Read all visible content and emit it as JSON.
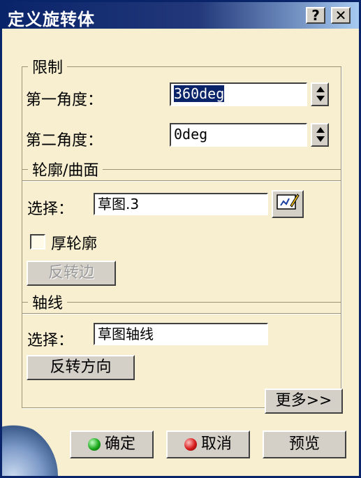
{
  "window": {
    "title": "定义旋转体",
    "help_label": "?",
    "close_label": "✕"
  },
  "limits": {
    "legend": "限制",
    "first_angle_label": "第一角度：",
    "first_angle_value": "360deg",
    "second_angle_label": "第二角度：",
    "second_angle_value": "0deg"
  },
  "profile": {
    "legend": "轮廓/曲面",
    "select_label": "选择：",
    "select_value": "草图.3",
    "thick_profile_label": "厚轮廓",
    "reverse_side_label": "反转边"
  },
  "axis": {
    "legend": "轴线",
    "select_label": "选择：",
    "select_value": "草图轴线",
    "reverse_direction_label": "反转方向"
  },
  "more_label": "更多>>",
  "buttons": {
    "ok_label": "确定",
    "cancel_label": "取消",
    "preview_label": "预览"
  },
  "icons": {
    "sketch_button": "sketch-edit-icon",
    "ok_indicator": "green-ball-icon",
    "cancel_indicator": "red-ball-icon"
  },
  "colors": {
    "dialog_bg": "#f7efd0",
    "titlebar": "#0a246a"
  }
}
